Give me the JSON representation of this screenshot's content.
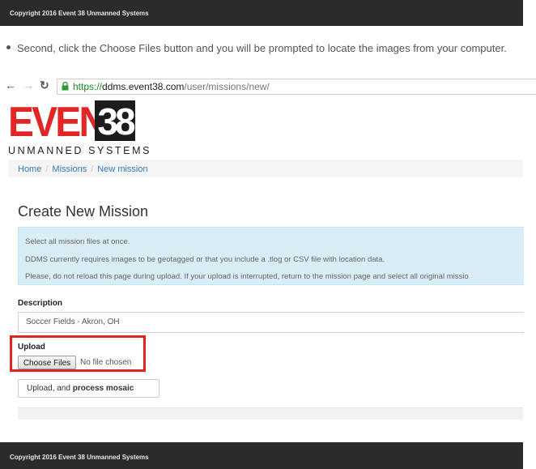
{
  "header": {
    "copyright": "Copyright 2016 Event 38 Unmanned Systems"
  },
  "instruction": "Second, click the Choose Files button and you will be prompted to locate the images from your computer.",
  "browser": {
    "url_scheme": "https://",
    "url_host": "ddms.event38.com",
    "url_path": "/user/missions/new/"
  },
  "logo": {
    "word": "EVENT",
    "number": "38",
    "tagline": "UNMANNED SYSTEMS"
  },
  "breadcrumb": [
    "Home",
    "Missions",
    "New mission"
  ],
  "page_title": "Create New Mission",
  "alert": {
    "line1": "Select all mission files at once.",
    "line2": "DDMS currently requires images to be geotagged or that you include a .tlog or CSV file with location data.",
    "line3": "Please, do not reload this page during upload. If your upload is interrupted, return to the mission page and select all original missio"
  },
  "form": {
    "description_label": "Description",
    "description_value": "Soccer Fields - Akron, OH",
    "upload_label": "Upload",
    "choose_files": "Choose Files",
    "no_file": "No file chosen",
    "upload_btn_prefix": "Upload, and ",
    "upload_btn_bold": "process mosaic"
  },
  "footer": {
    "copyright": "Copyright 2016 Event 38 Unmanned Systems"
  },
  "colors": {
    "highlight": "#e1251b",
    "logo_red": "#e32526",
    "link": "#337ab7",
    "alert_bg": "#d9edf7"
  }
}
